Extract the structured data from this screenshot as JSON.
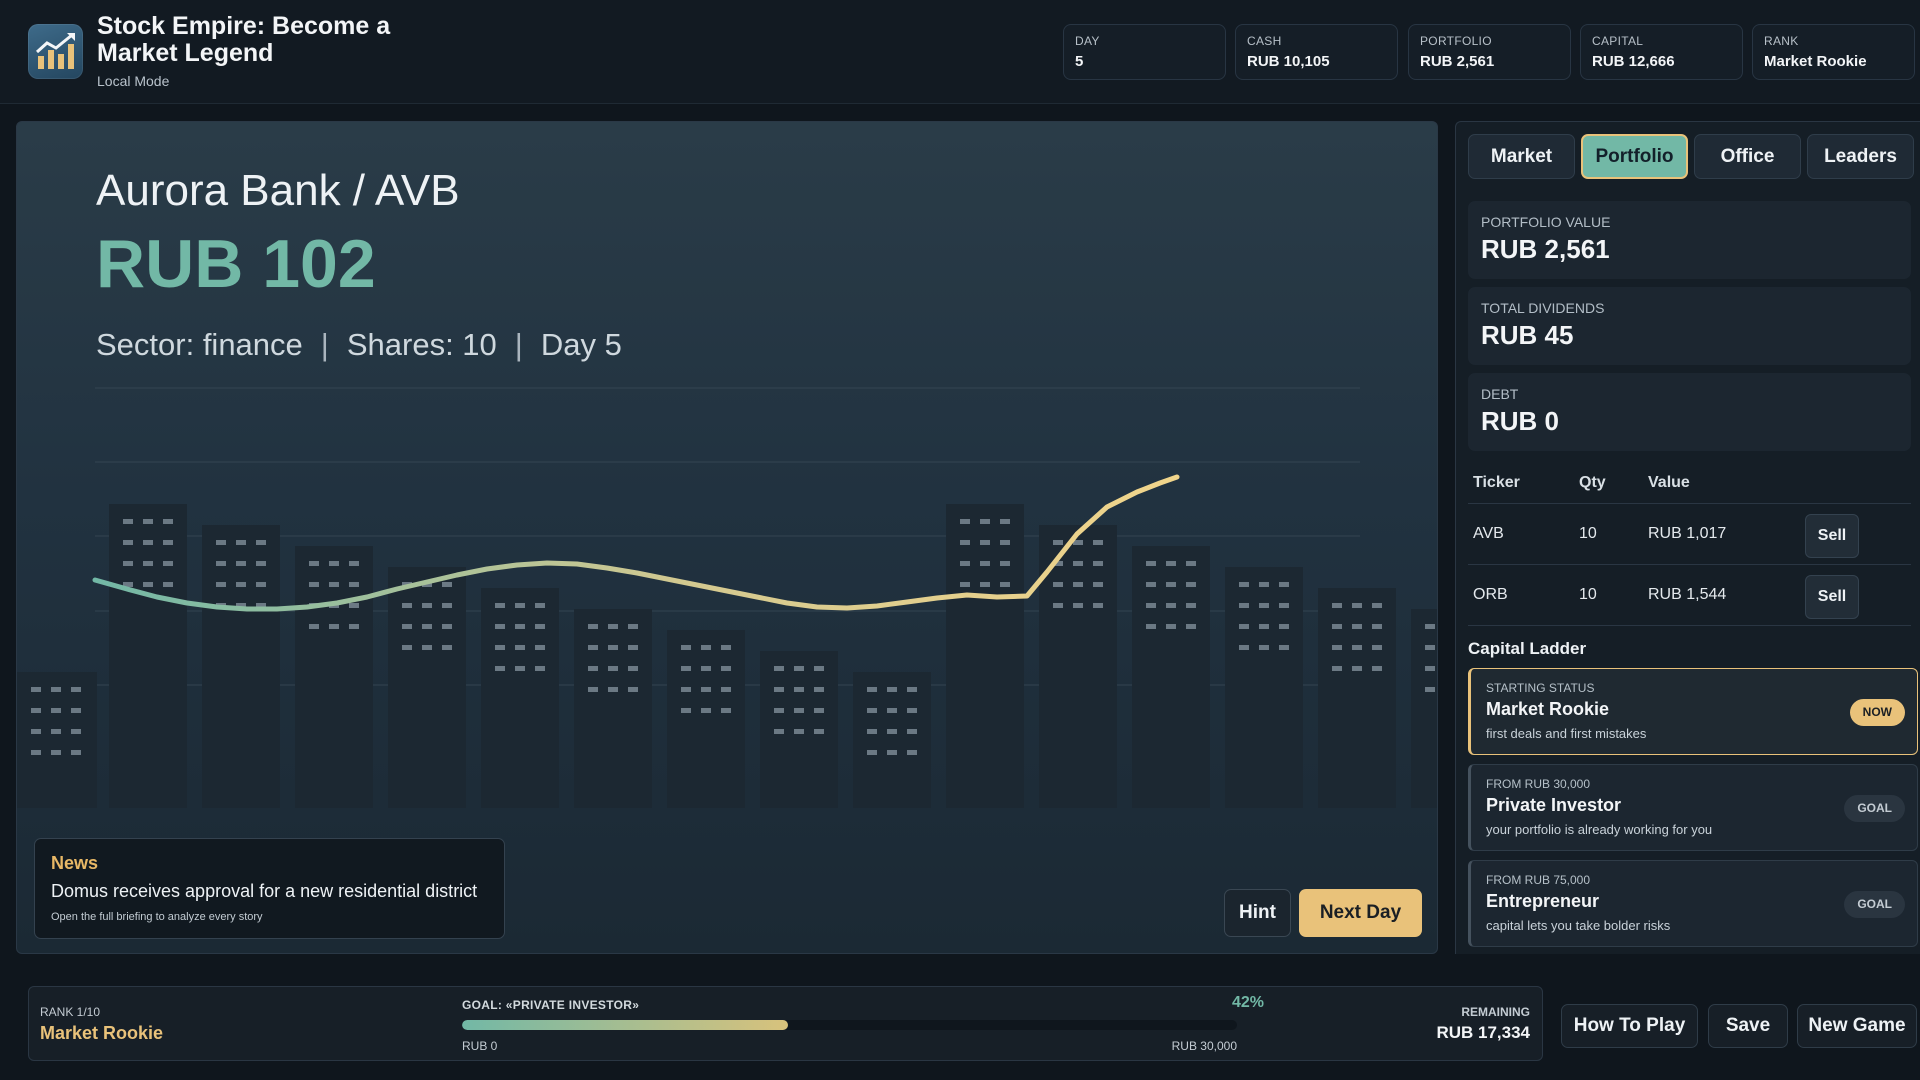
{
  "header": {
    "title": "Stock Empire: Become a Market Legend",
    "subtitle": "Local Mode",
    "logo_icon": "rising-chart-icon",
    "stats": [
      {
        "label": "DAY",
        "value": "5"
      },
      {
        "label": "CASH",
        "value": "RUB 10,105"
      },
      {
        "label": "PORTFOLIO",
        "value": "RUB 2,561"
      },
      {
        "label": "CAPITAL",
        "value": "RUB 12,666"
      },
      {
        "label": "RANK",
        "value": "Market Rookie"
      }
    ]
  },
  "stock": {
    "title": "Aurora Bank / AVB",
    "price": "RUB 102",
    "sector": "Sector: finance",
    "shares": "Shares: 10",
    "day": "Day 5"
  },
  "news": {
    "title": "News",
    "headline": "Domus receives approval for a new residential district",
    "sub": "Open the full briefing to analyze every story"
  },
  "actions": {
    "hint": "Hint",
    "next_day": "Next Day"
  },
  "tabs": [
    {
      "label": "Market",
      "active": false
    },
    {
      "label": "Portfolio",
      "active": true
    },
    {
      "label": "Office",
      "active": false
    },
    {
      "label": "Leaders",
      "active": false
    }
  ],
  "portfolio": {
    "value_label": "PORTFOLIO VALUE",
    "value": "RUB 2,561",
    "dividends_label": "TOTAL DIVIDENDS",
    "dividends": "RUB 45",
    "debt_label": "DEBT",
    "debt": "RUB 0"
  },
  "holdings": {
    "columns": [
      "Ticker",
      "Qty",
      "Value"
    ],
    "sell_label": "Sell",
    "rows": [
      {
        "ticker": "AVB",
        "qty": "10",
        "value": "RUB 1,017"
      },
      {
        "ticker": "ORB",
        "qty": "10",
        "value": "RUB 1,544"
      }
    ]
  },
  "ladder": {
    "title": "Capital Ladder",
    "items": [
      {
        "small": "STARTING STATUS",
        "name": "Market Rookie",
        "desc": "first deals and first mistakes",
        "badge": "NOW"
      },
      {
        "small": "FROM RUB 30,000",
        "name": "Private Investor",
        "desc": "your portfolio is already working for you",
        "badge": "GOAL"
      },
      {
        "small": "FROM RUB 75,000",
        "name": "Entrepreneur",
        "desc": "capital lets you take bolder risks",
        "badge": "GOAL"
      }
    ]
  },
  "footer": {
    "rank_small": "RANK 1/10",
    "rank_name": "Market Rookie",
    "goal_label": "GOAL: «PRIVATE INVESTOR»",
    "goal_pct": "42%",
    "progress": 0.42,
    "goal_start": "RUB 0",
    "goal_end": "RUB 30,000",
    "remaining_label": "REMAINING",
    "remaining_value": "RUB 17,334"
  },
  "footer_buttons": {
    "how_to_play": "How To Play",
    "save": "Save",
    "new_game": "New Game"
  },
  "colors": {
    "accent_teal": "#72b8a6",
    "accent_gold": "#e9c27a",
    "background": "#0f161d"
  }
}
